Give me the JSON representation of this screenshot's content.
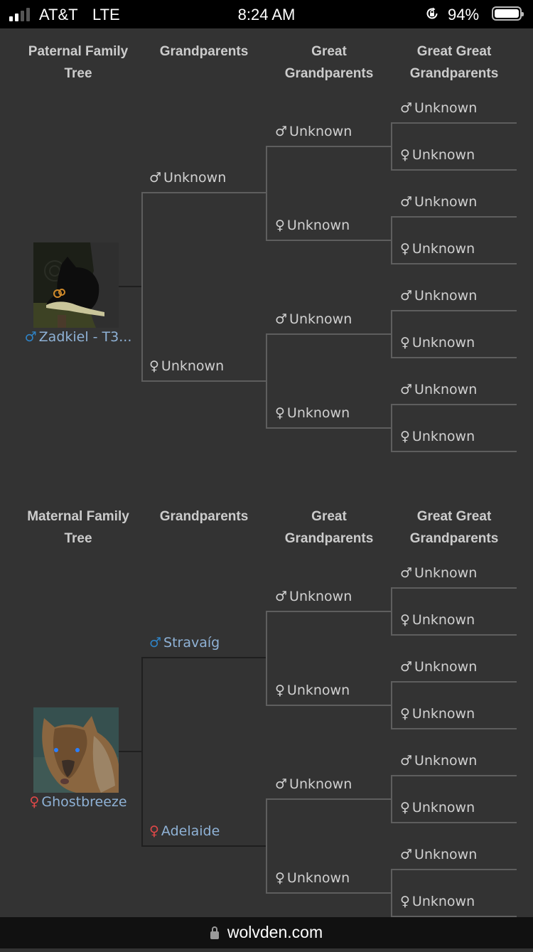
{
  "status_bar": {
    "carrier": "AT&T",
    "network": "LTE",
    "time": "8:24 AM",
    "battery_percent": "94%",
    "signal_bars_active": 2,
    "signal_bars_total": 4
  },
  "colors": {
    "background": "#333333",
    "male_known": "#2f82c4",
    "female_known": "#e04848",
    "known_name": "#8fb2d6",
    "unknown_text": "#d0d0d0"
  },
  "trees": [
    {
      "headers": [
        "Paternal Family Tree",
        "Grandparents",
        "Great Grandparents",
        "Great Great Grandparents"
      ],
      "header_lines": [
        [
          "Paternal Family",
          "Tree"
        ],
        [
          "Grandparents"
        ],
        [
          "Great",
          "Grandparents"
        ],
        [
          "Great Great",
          "Grandparents"
        ]
      ],
      "self": {
        "sex_symbol": "♂",
        "sex": "male",
        "name": "Zadkiel - T3...",
        "avatar": "black wolf with goggles and lantern"
      },
      "grandparents": [
        {
          "sex_symbol": "♂",
          "sex": "male",
          "name": "Unknown",
          "known": false
        },
        {
          "sex_symbol": "♀",
          "sex": "female",
          "name": "Unknown",
          "known": false
        }
      ],
      "great_grandparents": [
        {
          "sex_symbol": "♂",
          "name": "Unknown"
        },
        {
          "sex_symbol": "♀",
          "name": "Unknown"
        },
        {
          "sex_symbol": "♂",
          "name": "Unknown"
        },
        {
          "sex_symbol": "♀",
          "name": "Unknown"
        }
      ],
      "great_great_grandparents": [
        {
          "sex_symbol": "♂",
          "name": "Unknown"
        },
        {
          "sex_symbol": "♀",
          "name": "Unknown"
        },
        {
          "sex_symbol": "♂",
          "name": "Unknown"
        },
        {
          "sex_symbol": "♀",
          "name": "Unknown"
        },
        {
          "sex_symbol": "♂",
          "name": "Unknown"
        },
        {
          "sex_symbol": "♀",
          "name": "Unknown"
        },
        {
          "sex_symbol": "♂",
          "name": "Unknown"
        },
        {
          "sex_symbol": "♀",
          "name": "Unknown"
        }
      ]
    },
    {
      "headers": [
        "Maternal Family Tree",
        "Grandparents",
        "Great Grandparents",
        "Great Great Grandparents"
      ],
      "header_lines": [
        [
          "Maternal Family",
          "Tree"
        ],
        [
          "Grandparents"
        ],
        [
          "Great",
          "Grandparents"
        ],
        [
          "Great Great",
          "Grandparents"
        ]
      ],
      "self": {
        "sex_symbol": "♀",
        "sex": "female",
        "name": "Ghostbreeze",
        "avatar": "brown wolf with blue eyes"
      },
      "grandparents": [
        {
          "sex_symbol": "♂",
          "sex": "male",
          "name": "Stravaíg",
          "known": true
        },
        {
          "sex_symbol": "♀",
          "sex": "female",
          "name": "Adelaide",
          "known": true
        }
      ],
      "great_grandparents": [
        {
          "sex_symbol": "♂",
          "name": "Unknown"
        },
        {
          "sex_symbol": "♀",
          "name": "Unknown"
        },
        {
          "sex_symbol": "♂",
          "name": "Unknown"
        },
        {
          "sex_symbol": "♀",
          "name": "Unknown"
        }
      ],
      "great_great_grandparents": [
        {
          "sex_symbol": "♂",
          "name": "Unknown"
        },
        {
          "sex_symbol": "♀",
          "name": "Unknown"
        },
        {
          "sex_symbol": "♂",
          "name": "Unknown"
        },
        {
          "sex_symbol": "♀",
          "name": "Unknown"
        },
        {
          "sex_symbol": "♂",
          "name": "Unknown"
        },
        {
          "sex_symbol": "♀",
          "name": "Unknown"
        },
        {
          "sex_symbol": "♂",
          "name": "Unknown"
        },
        {
          "sex_symbol": "♀",
          "name": "Unknown"
        }
      ]
    }
  ],
  "browser": {
    "url": "wolvden.com",
    "lock_icon": "padlock-icon"
  }
}
